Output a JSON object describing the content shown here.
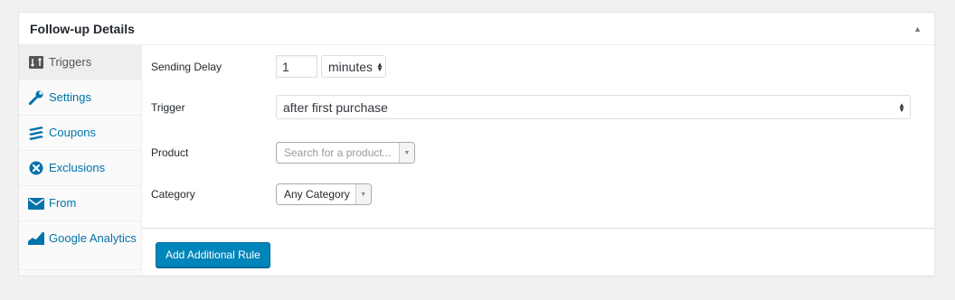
{
  "panel": {
    "title": "Follow-up Details",
    "toggle_icon": "triangle-up-icon"
  },
  "tabs": [
    {
      "label": "Triggers",
      "icon": "triggers-icon",
      "active": true
    },
    {
      "label": "Settings",
      "icon": "wrench-icon"
    },
    {
      "label": "Coupons",
      "icon": "coupons-icon"
    },
    {
      "label": "Exclusions",
      "icon": "exclusions-icon"
    },
    {
      "label": "From",
      "icon": "envelope-icon"
    },
    {
      "label": "Google Analytics",
      "icon": "analytics-icon"
    }
  ],
  "form": {
    "sending_delay": {
      "label": "Sending Delay",
      "value": "1",
      "unit": "minutes"
    },
    "trigger": {
      "label": "Trigger",
      "value": "after first purchase"
    },
    "product": {
      "label": "Product",
      "placeholder": "Search for a product..."
    },
    "category": {
      "label": "Category",
      "value": "Any Category"
    }
  },
  "actions": {
    "add_rule": "Add Additional Rule"
  },
  "colors": {
    "accent": "#0085ba",
    "link": "#0073aa",
    "panel_bg": "#ffffff",
    "page_bg": "#f1f1f1"
  }
}
